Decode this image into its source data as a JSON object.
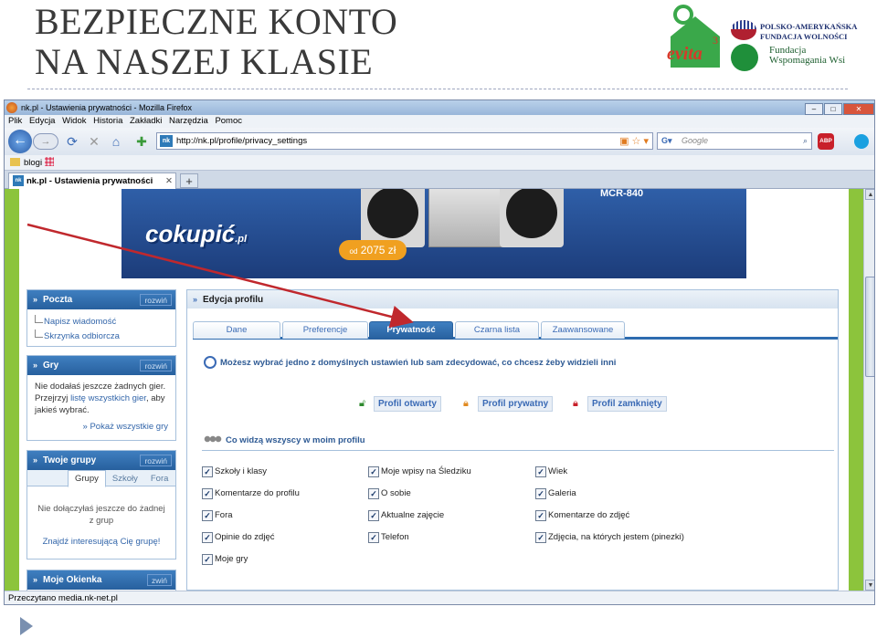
{
  "slide": {
    "title_line1": "BEZPIECZNE KONTO",
    "title_line2": "NA NASZEJ KLASIE",
    "logos": {
      "evita": "evita",
      "paff_line1": "POLSKO-AMERYKAŃSKA",
      "paff_line2": "FUNDACJA WOLNOŚCI",
      "fww_line1": "Fundacja",
      "fww_line2": "Wspomagania Wsi"
    }
  },
  "browser": {
    "window_title": "nk.pl - Ustawienia prywatności - Mozilla Firefox",
    "menu": [
      "Plik",
      "Edycja",
      "Widok",
      "Historia",
      "Zakładki",
      "Narzędzia",
      "Pomoc"
    ],
    "url": "http://nk.pl/profile/privacy_settings",
    "search_placeholder": "Google",
    "bookmark": "blogi",
    "tab_title": "nk.pl - Ustawienia prywatności",
    "status": "Przeczytano media.nk-net.pl",
    "badge": "nk",
    "abp": "ABP"
  },
  "ad": {
    "model": "MCR-840",
    "brand": "cokupić",
    "brand_tld": ".pl",
    "price_prefix": "od",
    "price": "2075 zł"
  },
  "sidebar": {
    "poczta": {
      "title": "Poczta",
      "expand": "rozwiń",
      "items": [
        "Napisz wiadomość",
        "Skrzynka odbiorcza"
      ]
    },
    "gry": {
      "title": "Gry",
      "expand": "rozwiń",
      "text1": "Nie dodałaś jeszcze żadnych gier. Przejrzyj",
      "link": "listę wszystkich gier",
      "text2": ", aby jakieś wybrać.",
      "more": "» Pokaż wszystkie gry"
    },
    "grupy": {
      "title": "Twoje grupy",
      "expand": "rozwiń",
      "tabs": [
        "Grupy",
        "Szkoły",
        "Fora"
      ],
      "empty": "Nie dołączyłaś jeszcze do żadnej z grup",
      "find": "Znajdź interesującą Cię grupę!"
    },
    "okienka": {
      "title": "Moje Okienka",
      "expand": "zwiń"
    }
  },
  "panel": {
    "title": "Edycja profilu",
    "tabs": [
      "Dane",
      "Preferencje",
      "Prywatność",
      "Czarna lista",
      "Zaawansowane"
    ],
    "active_tab": "Prywatność",
    "info": "Możesz wybrać jedno z domyślnych ustawień lub sam zdecydować, co chcesz żeby widzieli inni",
    "profiles": [
      "Profil otwarty",
      "Profil prywatny",
      "Profil zamknięty"
    ],
    "section": "Co widzą wszyscy w moim profilu",
    "checkboxes": [
      [
        "Szkoły i klasy",
        "Moje wpisy na Śledziku",
        "Wiek"
      ],
      [
        "Komentarze do profilu",
        "O sobie",
        "Galeria"
      ],
      [
        "Fora",
        "Aktualne zajęcie",
        "Komentarze do zdjęć"
      ],
      [
        "Opinie do zdjęć",
        "Telefon",
        "Zdjęcia, na których jestem (pinezki)"
      ],
      [
        "Moje gry",
        "",
        ""
      ]
    ]
  },
  "colors": {
    "accent": "#27609e",
    "frame_green": "#8cc43c",
    "arrow_red": "#c0282d"
  }
}
